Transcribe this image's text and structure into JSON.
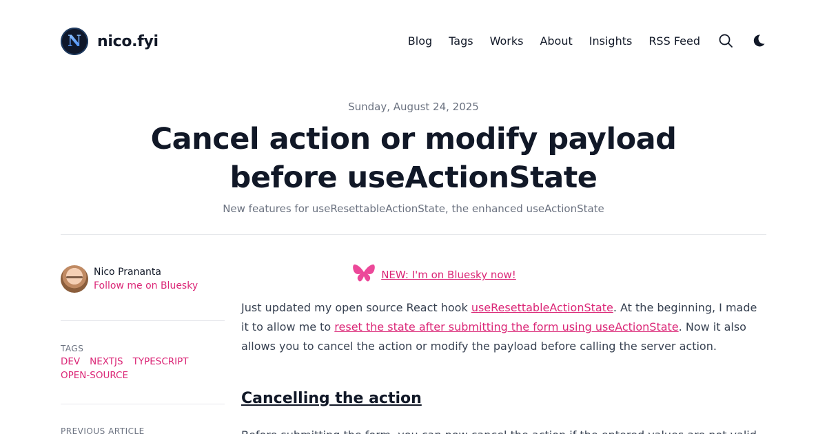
{
  "header": {
    "site_name": "nico.fyi",
    "logo_letter": "N",
    "nav": [
      "Blog",
      "Tags",
      "Works",
      "About",
      "Insights",
      "RSS Feed"
    ],
    "search_icon": "search-icon",
    "theme_icon": "moon-icon"
  },
  "post": {
    "date": "Sunday, August 24, 2025",
    "title": "Cancel action or modify payload before useActionState",
    "subtitle": "New features for useResettableActionState, the enhanced useActionState"
  },
  "sidebar": {
    "author_name": "Nico Prananta",
    "author_link": "Follow me on Bluesky",
    "tags_label": "TAGS",
    "tags": [
      "DEV",
      "NEXTJS",
      "TYPESCRIPT",
      "OPEN-SOURCE"
    ],
    "prev_label": "PREVIOUS ARTICLE"
  },
  "article": {
    "bluesky_link": "NEW: I'm on Bluesky now!",
    "p1_a": "Just updated my open source React hook ",
    "p1_link1": "useResettableActionState",
    "p1_b": ". At the beginning, I made it to allow me to ",
    "p1_link2": "reset the state after submitting the form using useActionState",
    "p1_c": ". Now it also allows you to cancel the action or modify the payload before calling the server action.",
    "h2": "Cancelling the action",
    "p2": "Before submitting the form, you can now cancel the action if the entered values are not valid."
  },
  "colors": {
    "accent": "#db2777",
    "text": "#111827",
    "muted": "#6b7280",
    "bluesky": "#ec4899"
  }
}
